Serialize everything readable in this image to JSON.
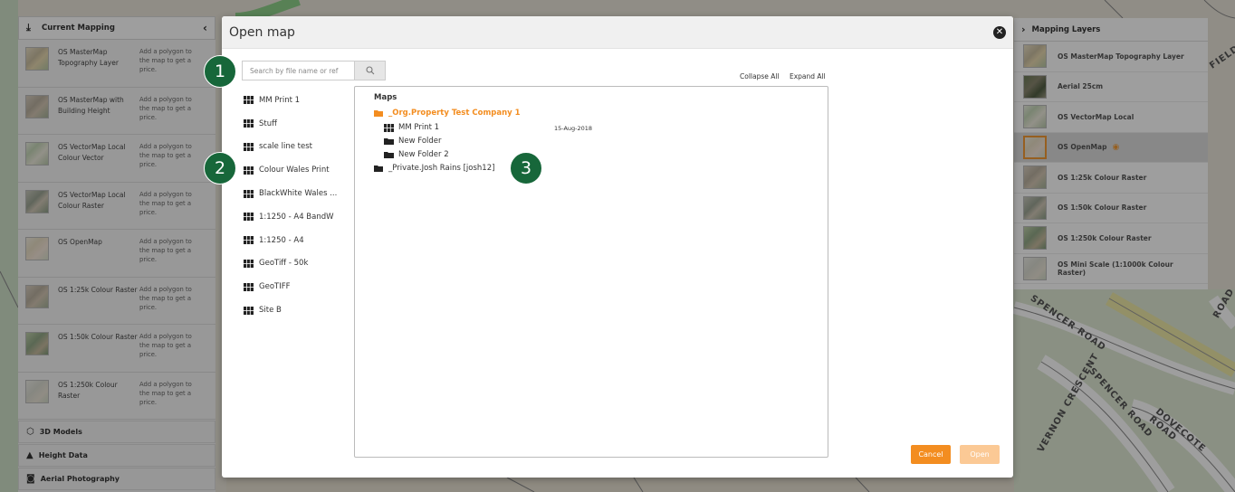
{
  "left_panel": {
    "title": "Current Mapping",
    "items": [
      {
        "name": "OS MasterMap Topography Layer",
        "desc": "Add a polygon to the map to get a price.",
        "thumb": "thumb-a"
      },
      {
        "name": "OS MasterMap with Building Height",
        "desc": "Add a polygon to the map to get a price.",
        "thumb": "thumb-e"
      },
      {
        "name": "OS VectorMap Local Colour Vector",
        "desc": "Add a polygon to the map to get a price.",
        "thumb": "thumb-c"
      },
      {
        "name": "OS VectorMap Local Colour Raster",
        "desc": "Add a polygon to the map to get a price.",
        "thumb": "thumb-f"
      },
      {
        "name": "OS OpenMap",
        "desc": "Add a polygon to the map to get a price.",
        "thumb": "thumb-d"
      },
      {
        "name": "OS 1:25k Colour Raster",
        "desc": "Add a polygon to the map to get a price.",
        "thumb": "thumb-e"
      },
      {
        "name": "OS 1:50k Colour Raster",
        "desc": "Add a polygon to the map to get a price.",
        "thumb": "thumb-g"
      },
      {
        "name": "OS 1:250k Colour Raster",
        "desc": "Add a polygon to the map to get a price.",
        "thumb": "thumb-h"
      }
    ],
    "sections": [
      {
        "label": "3D Models",
        "icon": "cube-icon"
      },
      {
        "label": "Height Data",
        "icon": "mountain-icon"
      },
      {
        "label": "Aerial Photography",
        "icon": "camera-icon"
      }
    ]
  },
  "right_panel": {
    "title": "Mapping Layers",
    "items": [
      {
        "label": "OS MasterMap Topography Layer",
        "thumb": "thumb-a",
        "selected": false
      },
      {
        "label": "Aerial 25cm",
        "thumb": "thumb-b",
        "selected": false
      },
      {
        "label": "OS VectorMap Local",
        "thumb": "thumb-c",
        "selected": false
      },
      {
        "label": "OS OpenMap",
        "thumb": "thumb-d",
        "selected": true
      },
      {
        "label": "OS 1:25k Colour Raster",
        "thumb": "thumb-e",
        "selected": false
      },
      {
        "label": "OS 1:50k Colour Raster",
        "thumb": "thumb-f",
        "selected": false
      },
      {
        "label": "OS 1:250k Colour Raster",
        "thumb": "thumb-g",
        "selected": false
      },
      {
        "label": "OS Mini Scale (1:1000k Colour Raster)",
        "thumb": "thumb-h",
        "selected": false
      }
    ]
  },
  "modal": {
    "title": "Open map",
    "search_placeholder": "Search by file name or ref",
    "recent": [
      "MM Print 1",
      "Stuff",
      "scale line test",
      "Colour Wales Print",
      "BlackWhite Wales ...",
      "1:1250 - A4 BandW",
      "1:1250 - A4",
      "GeoTiff - 50k",
      "GeoTIFF",
      "Site B"
    ],
    "collapse_all": "Collapse All",
    "expand_all": "Expand All",
    "tree": {
      "root": "Maps",
      "org_folder": "_Org.Property Test Company 1",
      "map_item": "MM Print 1",
      "map_date": "15-Aug-2018",
      "folder1": "New Folder",
      "folder2": "New Folder 2",
      "private_folder": "_Private.Josh Rains [josh12]"
    },
    "cancel_label": "Cancel",
    "open_label": "Open"
  },
  "map_labels": [
    "SPENCER ROAD",
    "VERNON CRESCENT",
    "SPENCER ROAD",
    "DOVECOTE ROAD",
    "FIELD",
    "ROAD"
  ],
  "badges": [
    "1",
    "2",
    "3"
  ],
  "colors": {
    "accent": "#f38d20",
    "badge": "#17673a",
    "accent_light": "#fbc995"
  }
}
